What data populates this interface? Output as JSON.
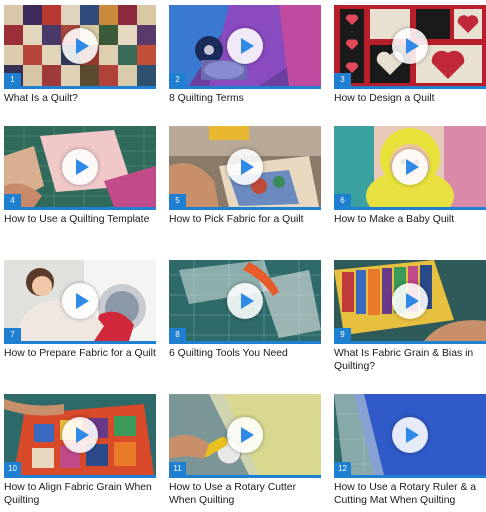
{
  "videos": [
    {
      "number": "1",
      "title": "What Is a Quilt?"
    },
    {
      "number": "2",
      "title": "8 Quilting Terms"
    },
    {
      "number": "3",
      "title": "How to Design a Quilt"
    },
    {
      "number": "4",
      "title": "How to Use a Quilting Template"
    },
    {
      "number": "5",
      "title": "How to Pick Fabric for a Quilt"
    },
    {
      "number": "6",
      "title": "How to Make a Baby Quilt"
    },
    {
      "number": "7",
      "title": "How to Prepare Fabric for a Quilt"
    },
    {
      "number": "8",
      "title": "6 Quilting Tools You Need"
    },
    {
      "number": "9",
      "title": "What Is Fabric Grain & Bias in Quilting?"
    },
    {
      "number": "10",
      "title": "How to Align Fabric Grain When Quilting"
    },
    {
      "number": "11",
      "title": "How to Use a Rotary Cutter When Quilting"
    },
    {
      "number": "12",
      "title": "How to Use a Rotary Ruler & a Cutting Mat When Quilting"
    }
  ],
  "colors": {
    "accent": "#1f7fd1",
    "play_icon": "#2e8ae6"
  },
  "icons": {
    "play": "play-icon"
  }
}
